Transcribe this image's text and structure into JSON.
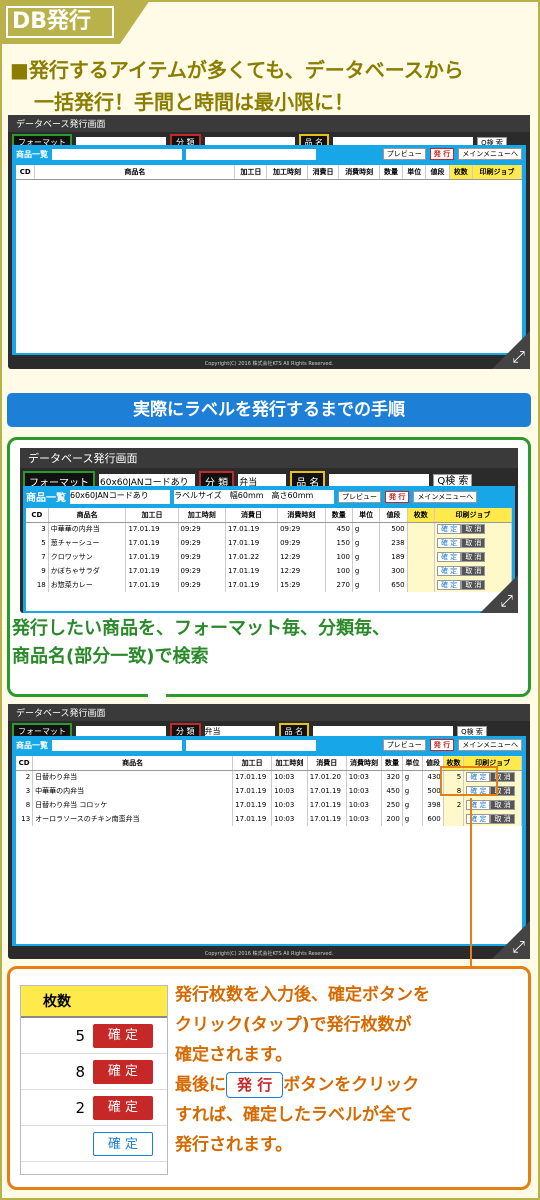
{
  "tag": "DB発行",
  "lead": {
    "line1": "■発行するアイテムが多くても、データベースから",
    "line2": "一括発行！手間と時間は最小限に！"
  },
  "window": {
    "title": "データベース発行画面",
    "format_label": "フォーマット",
    "category_label": "分 類",
    "name_label": "品 名",
    "search_button": "Q検 索",
    "list_label": "商品一覧",
    "preview_button": "プレビュー",
    "issue_button": "発 行",
    "menu_button": "メインメニューへ",
    "columns": [
      "CD",
      "商品名",
      "加工日",
      "加工時刻",
      "消費日",
      "消費時刻",
      "数量",
      "単位",
      "値段",
      "枚数",
      "印刷ジョブ"
    ],
    "copyright": "Copyright(C) 2016 株式会社KTS All Rights Reserved."
  },
  "window2": {
    "format_value": "60x60JANコードあり",
    "category_value": "弁当",
    "label_info": "ラベルサイズ　幅60mm　高さ60mm",
    "rows": [
      {
        "cd": "3",
        "name": "中華華の内弁当",
        "d1": "17.01.19",
        "t1": "09:29",
        "d2": "17.01.19",
        "t2": "09:29",
        "qty": "450",
        "unit": "g",
        "price": "500"
      },
      {
        "cd": "5",
        "name": "葱チャーシュー",
        "d1": "17.01.19",
        "t1": "09:29",
        "d2": "17.01.19",
        "t2": "09:29",
        "qty": "150",
        "unit": "g",
        "price": "238"
      },
      {
        "cd": "7",
        "name": "クロワッサン",
        "d1": "17.01.19",
        "t1": "09:29",
        "d2": "17.01.22",
        "t2": "12:29",
        "qty": "100",
        "unit": "g",
        "price": "189"
      },
      {
        "cd": "9",
        "name": "かぼちゃサラダ",
        "d1": "17.01.19",
        "t1": "09:29",
        "d2": "17.01.19",
        "t2": "12:29",
        "qty": "100",
        "unit": "g",
        "price": "300"
      },
      {
        "cd": "18",
        "name": "お惣菜カレー",
        "d1": "17.01.19",
        "t1": "09:29",
        "d2": "17.01.19",
        "t2": "15:29",
        "qty": "270",
        "unit": "g",
        "price": "650"
      }
    ],
    "confirm": "確 定",
    "cancel": "取 消"
  },
  "window3": {
    "category_value": "弁当",
    "rows": [
      {
        "cd": "2",
        "name": "日替わり弁当",
        "d1": "17.01.19",
        "t1": "10:03",
        "d2": "17.01.20",
        "t2": "10:03",
        "qty": "320",
        "unit": "g",
        "price": "430",
        "count": "5"
      },
      {
        "cd": "3",
        "name": "中華華の内弁当",
        "d1": "17.01.19",
        "t1": "10:03",
        "d2": "17.01.19",
        "t2": "10:03",
        "qty": "450",
        "unit": "g",
        "price": "500",
        "count": "8"
      },
      {
        "cd": "8",
        "name": "日替わり弁当 コロッケ",
        "d1": "17.01.19",
        "t1": "10:03",
        "d2": "17.01.19",
        "t2": "10:03",
        "qty": "250",
        "unit": "g",
        "price": "398",
        "count": "2"
      },
      {
        "cd": "13",
        "name": "オーロラソースのチキン南蛮弁当",
        "d1": "17.01.19",
        "t1": "10:03",
        "d2": "17.01.19",
        "t2": "10:03",
        "qty": "200",
        "unit": "g",
        "price": "600",
        "count": ""
      }
    ]
  },
  "heading": "実際にラベルを発行するまでの手順",
  "step1": {
    "line1": "発行したい商品を、フォーマット毎、分類毎、",
    "line2": "商品名(部分一致)で検索"
  },
  "step2": {
    "line1": "発行枚数を入力後、確定ボタンを",
    "line2": "クリック(タップ)で発行枚数が",
    "line3": "確定されます。",
    "line4a": "最後に",
    "button": "発 行",
    "line4b": "ボタンをクリック",
    "line5": "すれば、確定したラベルが全て",
    "line6": "発行されます。"
  },
  "zoom": {
    "header": "枚数",
    "counts": [
      "5",
      "8",
      "2",
      ""
    ],
    "confirm": "確 定"
  }
}
